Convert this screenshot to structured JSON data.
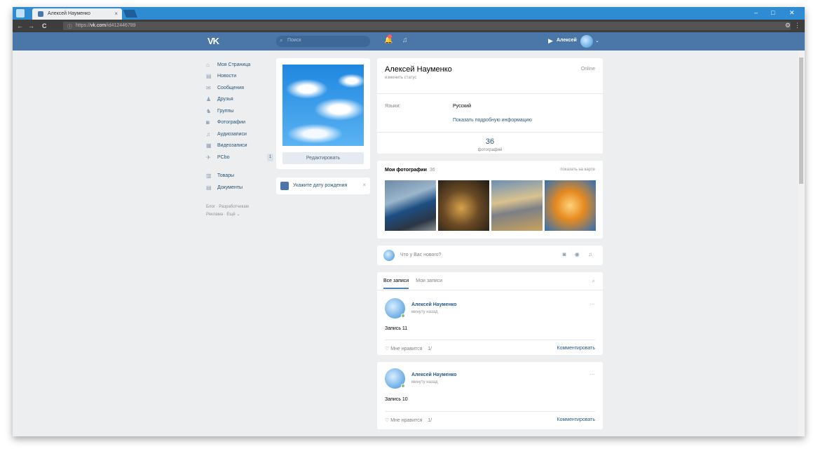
{
  "browser": {
    "tab_title": "Алексей Науменко",
    "tab_close": "×",
    "url_host": "vk.com",
    "url_prefix": "https://",
    "url_path": "/id412446789",
    "back": "←",
    "forward": "→",
    "reload": "C",
    "lock": "ⓘ",
    "win_min": "–",
    "win_max": "□",
    "win_close": "✕",
    "settings": "⚙",
    "kebab": "⋮"
  },
  "header": {
    "logo": "VK",
    "search_placeholder": "Поиск",
    "search_icon": "⌕",
    "notifications_icon": "🔔",
    "music_icon": "♫",
    "play_icon": "▶",
    "user_name": "Алексей",
    "chevron": "⌄"
  },
  "left_menu": {
    "items": [
      {
        "icon": "⌂",
        "label": "Моя Страница"
      },
      {
        "icon": "▤",
        "label": "Новости"
      },
      {
        "icon": "✉",
        "label": "Сообщения"
      },
      {
        "icon": "♟",
        "label": "Друзья"
      },
      {
        "icon": "♞",
        "label": "Группы"
      },
      {
        "icon": "◙",
        "label": "Фотографии"
      },
      {
        "icon": "♫",
        "label": "Аудиозаписи"
      },
      {
        "icon": "▦",
        "label": "Видеозаписи"
      },
      {
        "icon": "✈",
        "label": "PCbo",
        "count": "1"
      }
    ],
    "extra_items": [
      {
        "icon": "▥",
        "label": "Товары"
      },
      {
        "icon": "▤",
        "label": "Документы"
      }
    ],
    "footer_line1": "Блог · Разработчикам",
    "footer_line2": "Реклама · Ещё ⌄"
  },
  "profile": {
    "edit_button": "Редактировать",
    "birthday_prompt": "Укажите дату рождения",
    "birthday_close": "×",
    "name": "Алексей Науменко",
    "status_prompt": "изменить статус",
    "online": "Online",
    "languages_label": "Языки:",
    "languages_value": "Русский",
    "more_info": "Показать подробную информацию",
    "photos_count": "36",
    "photos_label": "фотографий"
  },
  "photos": {
    "title": "Мои фотографии",
    "count": "36",
    "map_link": "показать на карте"
  },
  "compose": {
    "placeholder": "Что у Вас нового?",
    "icons": "◙ ◉ ♫"
  },
  "wall": {
    "tab_all": "Все записи",
    "tab_mine": "Мои записи",
    "search_icon": "⌕",
    "posts": [
      {
        "author": "Алексей Науменко",
        "time": "минуту назад",
        "more": "···",
        "text": "Запись 11",
        "like": "♡ Мне нравится",
        "like_count": "1/",
        "comment": "Комментировать"
      },
      {
        "author": "Алексей Науменко",
        "time": "минуту назад",
        "more": "···",
        "text": "Запись 10",
        "like": "♡ Мне нравится",
        "like_count": "1/",
        "comment": "Комментировать"
      }
    ]
  },
  "colors": {
    "vk_blue": "#4a76a8",
    "chrome_blue": "#2f8cd3",
    "page_bg": "#edeef0"
  }
}
